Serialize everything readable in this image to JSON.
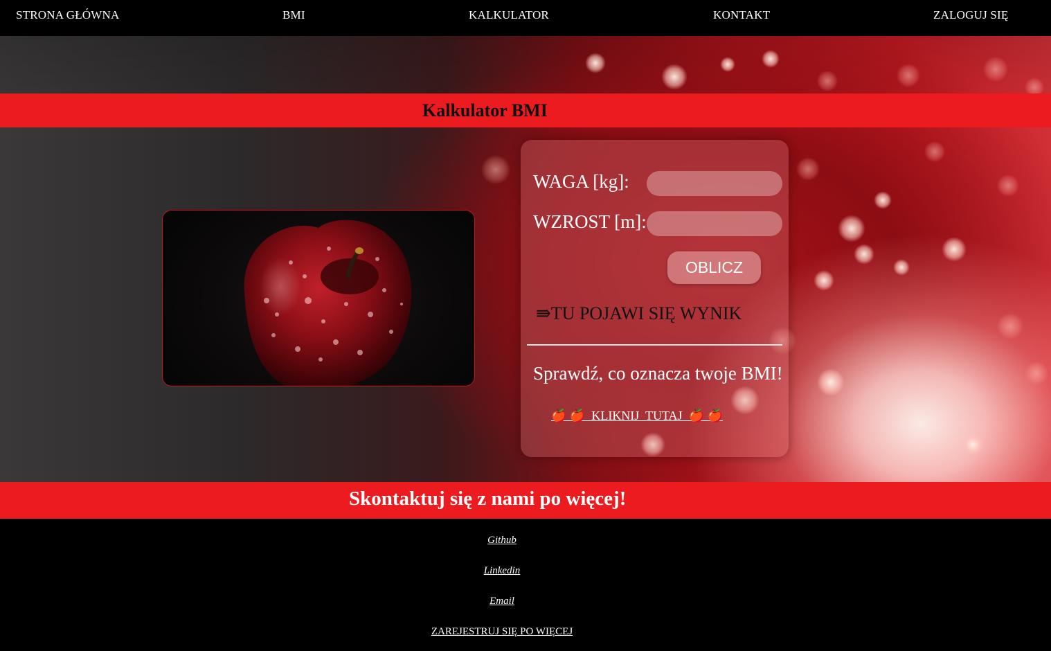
{
  "nav": {
    "items": [
      {
        "label": "STRONA GŁÓWNA"
      },
      {
        "label": "BMI"
      },
      {
        "label": "KALKULATOR"
      },
      {
        "label": "KONTAKT"
      },
      {
        "label": "ZALOGUJ SIĘ"
      }
    ]
  },
  "calculator": {
    "title": "Kalkulator BMI",
    "weight_label": "WAGA [kg]:",
    "weight_value": "",
    "height_label": "WZROST [m]:",
    "height_value": "",
    "calculate_button": "OBLICZ",
    "result_text": "⇛TU POJAWI SIĘ WYNIK",
    "check_text": "Sprawdź, co oznacza twoje BMI!",
    "click_link": "🍎 🍎  KLIKNIJ  TUTAJ  🍎 🍎"
  },
  "contact": {
    "heading": "Skontaktuj się z nami po więcej!",
    "links": [
      {
        "label": "Github"
      },
      {
        "label": "Linkedin"
      },
      {
        "label": "Email"
      }
    ],
    "register_link": "ZAREJESTRUJ SIĘ PO WIĘCEJ"
  },
  "colors": {
    "accent_red": "#ec1b1f",
    "nav_bg": "#000000",
    "footer_bg": "#000000"
  },
  "images": {
    "apple": "apple-with-water-drops"
  }
}
